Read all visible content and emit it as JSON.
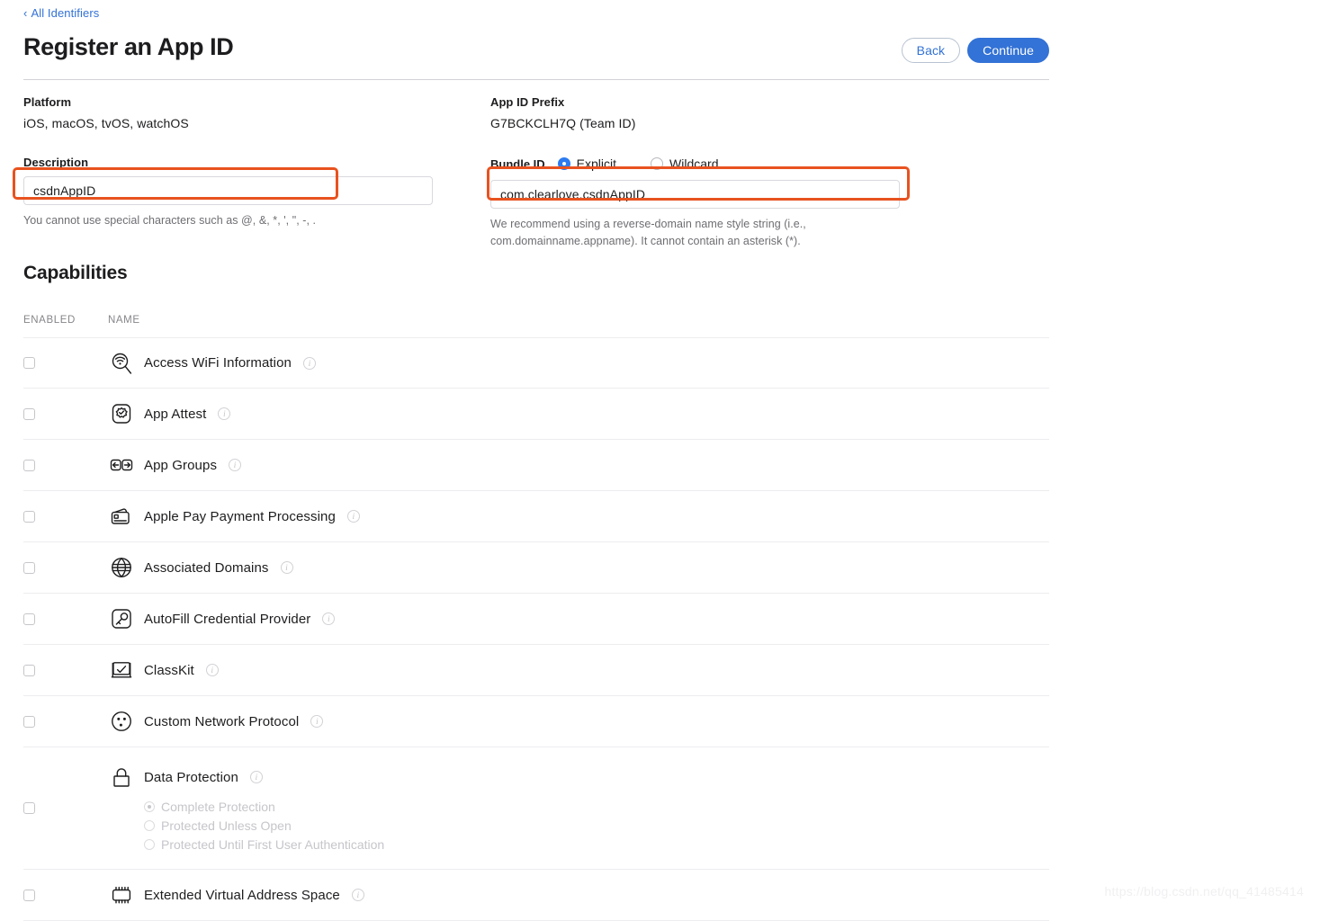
{
  "breadcrumb": {
    "chevron": "‹",
    "label": "All Identifiers"
  },
  "header": {
    "title": "Register an App ID",
    "back_label": "Back",
    "continue_label": "Continue"
  },
  "form": {
    "platform_label": "Platform",
    "platform_value": "iOS, macOS, tvOS, watchOS",
    "description_label": "Description",
    "description_value": "csdnAppID",
    "description_helper": "You cannot use special characters such as @, &, *, ', \", -, .",
    "prefix_label": "App ID Prefix",
    "prefix_value": "G7BCKCLH7Q (Team ID)",
    "bundle_label": "Bundle ID",
    "bundle_explicit_label": "Explicit",
    "bundle_wildcard_label": "Wildcard",
    "bundle_selected": "Explicit",
    "bundle_value": "com.clearlove.csdnAppID",
    "bundle_helper": "We recommend using a reverse-domain name style string (i.e., com.domainname.appname). It cannot contain an asterisk (*)."
  },
  "capabilities": {
    "title": "Capabilities",
    "col_enabled": "ENABLED",
    "col_name": "NAME",
    "info_glyph": "i",
    "rows": [
      {
        "name": "Access WiFi Information",
        "icon": "wifi-magnifier-icon",
        "enabled": false
      },
      {
        "name": "App Attest",
        "icon": "attest-badge-icon",
        "enabled": false
      },
      {
        "name": "App Groups",
        "icon": "app-groups-arrows-icon",
        "enabled": false
      },
      {
        "name": "Apple Pay Payment Processing",
        "icon": "payment-cards-icon",
        "enabled": false
      },
      {
        "name": "Associated Domains",
        "icon": "globe-icon",
        "enabled": false
      },
      {
        "name": "AutoFill Credential Provider",
        "icon": "key-square-icon",
        "enabled": false
      },
      {
        "name": "ClassKit",
        "icon": "classkit-board-icon",
        "enabled": false
      },
      {
        "name": "Custom Network Protocol",
        "icon": "network-nodes-icon",
        "enabled": false
      },
      {
        "name": "Data Protection",
        "icon": "lock-icon",
        "enabled": false,
        "sub_options": [
          {
            "label": "Complete Protection",
            "selected": true
          },
          {
            "label": "Protected Unless Open",
            "selected": false
          },
          {
            "label": "Protected Until First User Authentication",
            "selected": false
          }
        ]
      },
      {
        "name": "Extended Virtual Address Space",
        "icon": "chip-icon",
        "enabled": false
      }
    ]
  },
  "watermark": "https://blog.csdn.net/qq_41485414",
  "colors": {
    "accent_blue": "#3372d6",
    "link_blue": "#3372d6",
    "radio_blue": "#2d7bf0",
    "annotation_orange": "#e8521f",
    "divider": "#ededf0",
    "muted_text": "#6e6e73"
  }
}
